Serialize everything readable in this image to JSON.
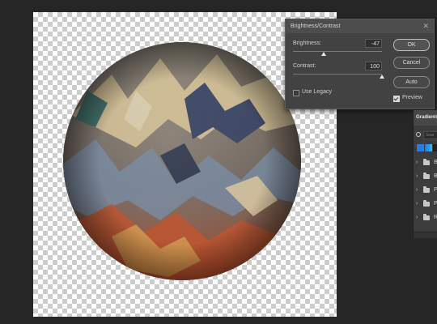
{
  "dialog": {
    "title": "Brightness/Contrast",
    "close_glyph": "✕",
    "brightness_label": "Brightness:",
    "brightness_value": "-47",
    "contrast_label": "Contrast:",
    "contrast_value": "100",
    "legacy_label": "Use Legacy",
    "legacy_checked": false,
    "preview_label": "Preview",
    "preview_checked": true,
    "ok_label": "OK",
    "cancel_label": "Cancel",
    "auto_label": "Auto"
  },
  "panel": {
    "tab_label": "Gradients",
    "search_placeholder": "Sear",
    "folders": [
      {
        "letter": "B"
      },
      {
        "letter": "B"
      },
      {
        "letter": "P"
      },
      {
        "letter": "P"
      },
      {
        "letter": "R"
      }
    ],
    "chevron_glyph": "›"
  },
  "colors": {
    "app_background": "#262626",
    "dialog_background": "#424242",
    "swatch_1": "#2a7be0",
    "swatch_2": "#1aa3ff",
    "swatch_3": "#222222"
  }
}
